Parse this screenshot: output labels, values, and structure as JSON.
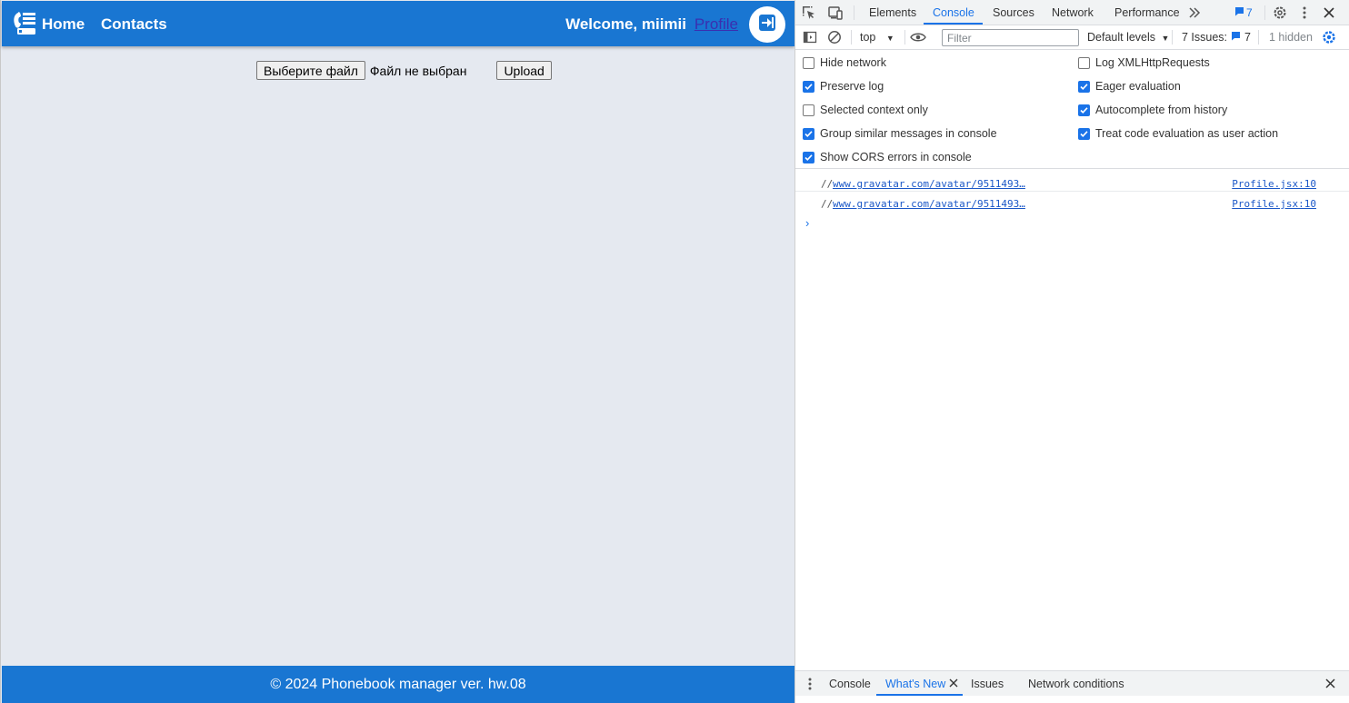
{
  "app": {
    "nav": {
      "home": "Home",
      "contacts": "Contacts"
    },
    "welcome": "Welcome, miimii",
    "profile_link": "Profile",
    "upload": {
      "choose_file": "Выберите файл",
      "file_status": "Файл не выбран",
      "upload_button": "Upload"
    },
    "footer": "© 2024 Phonebook manager ver. hw.08",
    "colors": {
      "header": "#1976d2",
      "background": "#e5e9f0"
    }
  },
  "devtools": {
    "tabs": [
      "Elements",
      "Console",
      "Sources",
      "Network",
      "Performance"
    ],
    "active_tab": "Console",
    "message_badge": "7",
    "toolbar": {
      "context": "top",
      "filter_placeholder": "Filter",
      "levels": "Default levels",
      "issues_label": "7 Issues:",
      "issues_count": "7",
      "hidden": "1 hidden"
    },
    "settings_left": [
      {
        "label": "Hide network",
        "checked": false
      },
      {
        "label": "Preserve log",
        "checked": true
      },
      {
        "label": "Selected context only",
        "checked": false
      },
      {
        "label": "Group similar messages in console",
        "checked": true
      },
      {
        "label": "Show CORS errors in console",
        "checked": true
      }
    ],
    "settings_right": [
      {
        "label": "Log XMLHttpRequests",
        "checked": false
      },
      {
        "label": "Eager evaluation",
        "checked": true
      },
      {
        "label": "Autocomplete from history",
        "checked": true
      },
      {
        "label": "Treat code evaluation as user action",
        "checked": true
      }
    ],
    "console_messages": [
      {
        "prefix": "//",
        "link": "www.gravatar.com/avatar/9511493…",
        "source": "Profile.jsx:10"
      },
      {
        "prefix": "//",
        "link": "www.gravatar.com/avatar/9511493…",
        "source": "Profile.jsx:10"
      }
    ],
    "drawer_tabs": [
      "Console",
      "What's New",
      "Issues",
      "Network conditions"
    ],
    "drawer_active": "What's New"
  }
}
